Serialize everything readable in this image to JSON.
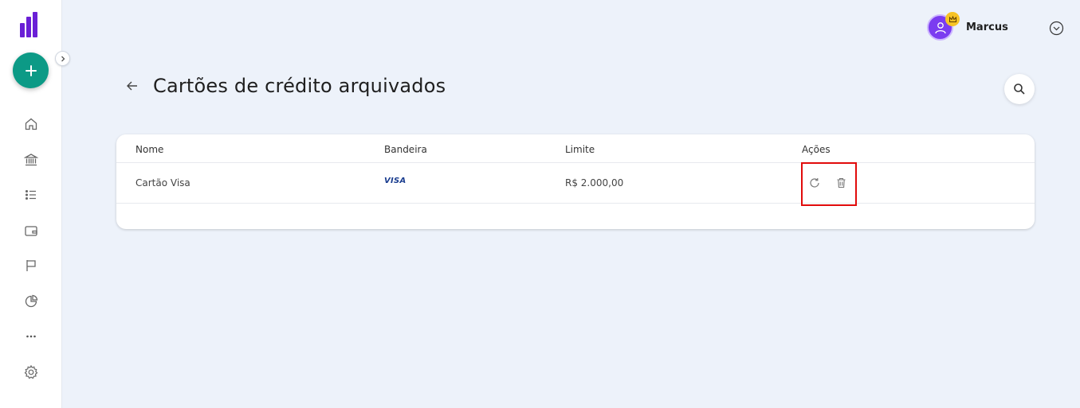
{
  "user": {
    "name": "Marcus"
  },
  "page": {
    "title": "Cartões de crédito arquivados"
  },
  "table": {
    "columns": [
      "Nome",
      "Bandeira",
      "Limite",
      "Ações"
    ],
    "rows": [
      {
        "nome": "Cartão Visa",
        "bandeira": "VISA",
        "limite": "R$ 2.000,00"
      }
    ]
  },
  "icons": {
    "fab": "plus-icon",
    "collapse": "chevron-right-icon",
    "nav": [
      "home-icon",
      "bank-icon",
      "list-icon",
      "wallet-icon",
      "flag-icon",
      "pie-chart-icon",
      "more-icon",
      "gear-icon"
    ],
    "actions": [
      "restore-icon",
      "trash-icon"
    ]
  },
  "colors": {
    "brand": "#6a1fd6",
    "fab": "#0c9a86",
    "background": "#edf2fa",
    "highlight": "#e10b0b"
  }
}
